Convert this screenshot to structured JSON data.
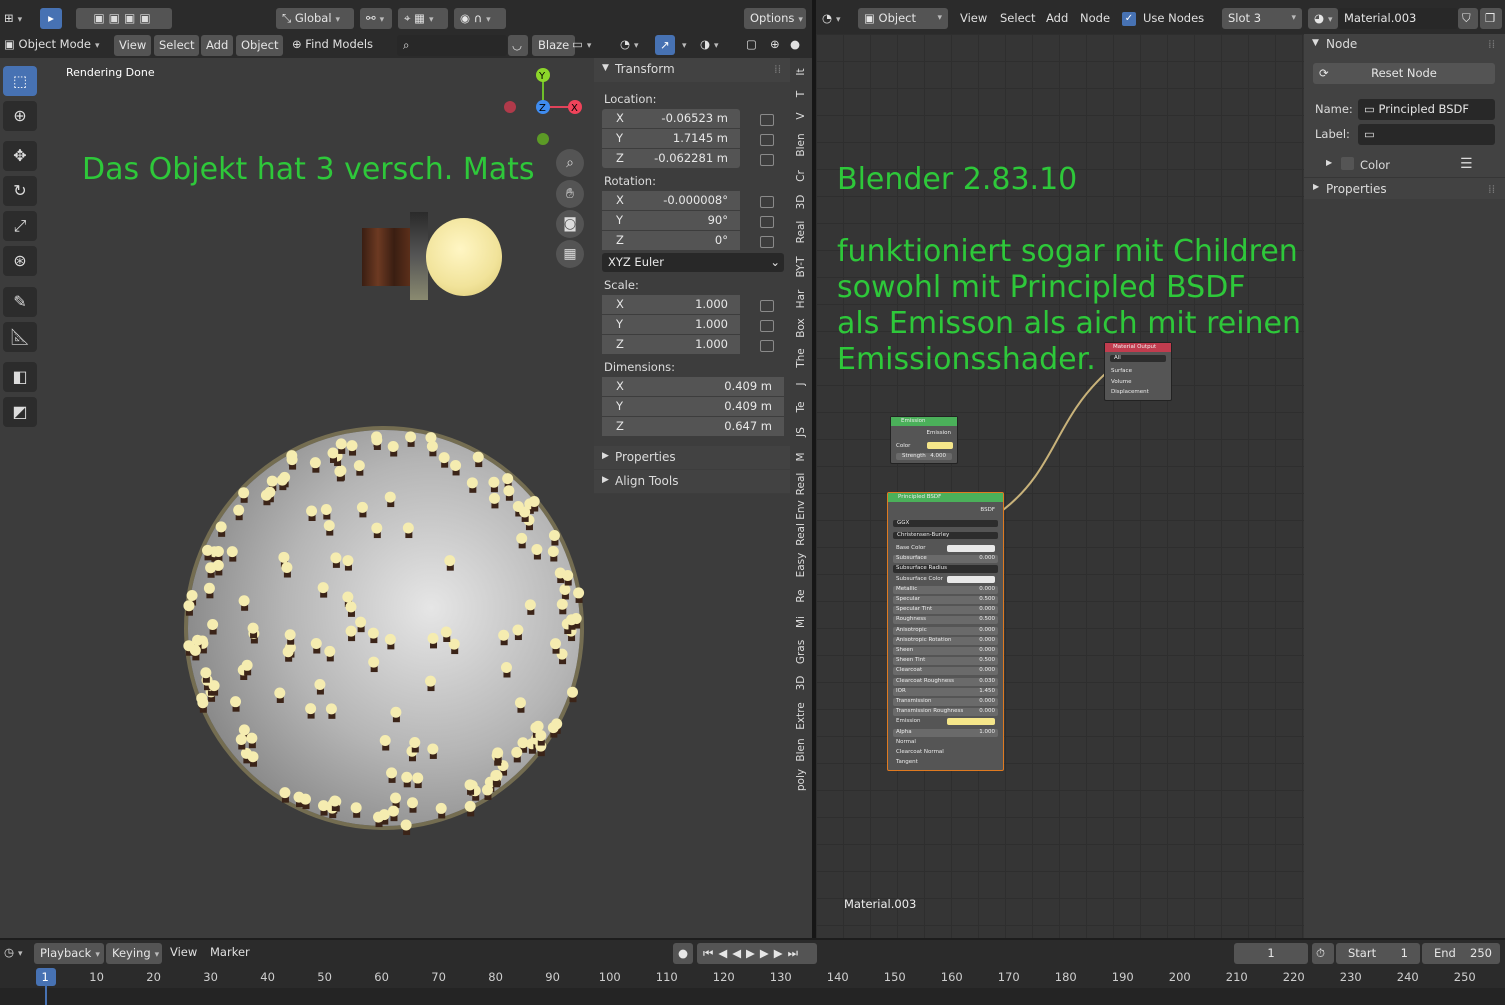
{
  "viewport": {
    "header": {
      "orientation": "Global",
      "options": "Options",
      "mode": "Object Mode",
      "menus": [
        "View",
        "Select",
        "Add",
        "Object"
      ],
      "find_models": "Find Models",
      "blaze": "Blaze"
    },
    "status_text": "Rendering Done",
    "overlay_text": "Das Objekt hat 3 versch. Mats"
  },
  "transform": {
    "title": "Transform",
    "location_label": "Location:",
    "location": [
      {
        "axis": "X",
        "value": "-0.06523 m"
      },
      {
        "axis": "Y",
        "value": "1.7145 m"
      },
      {
        "axis": "Z",
        "value": "-0.062281 m"
      }
    ],
    "rotation_label": "Rotation:",
    "rotation": [
      {
        "axis": "X",
        "value": "-0.000008°"
      },
      {
        "axis": "Y",
        "value": "90°"
      },
      {
        "axis": "Z",
        "value": "0°"
      }
    ],
    "rotation_mode": "XYZ Euler",
    "scale_label": "Scale:",
    "scale": [
      {
        "axis": "X",
        "value": "1.000"
      },
      {
        "axis": "Y",
        "value": "1.000"
      },
      {
        "axis": "Z",
        "value": "1.000"
      }
    ],
    "dimensions_label": "Dimensions:",
    "dimensions": [
      {
        "axis": "X",
        "value": "0.409 m"
      },
      {
        "axis": "Y",
        "value": "0.409 m"
      },
      {
        "axis": "Z",
        "value": "0.647 m"
      }
    ],
    "properties": "Properties",
    "align_tools": "Align Tools"
  },
  "vertical_tabs": [
    "It",
    "T",
    "V",
    "Blen",
    "Cr",
    "3D",
    "Real",
    "BY-T",
    "Har",
    "Box",
    "The",
    "J",
    "Te",
    "JS",
    "M",
    "Real",
    "Real Env",
    "Easy",
    "Re",
    "Mi",
    "Gras",
    "3D",
    "Extre",
    "Blen",
    "poly"
  ],
  "node_editor": {
    "header": {
      "object": "Object",
      "menus": [
        "View",
        "Select",
        "Add",
        "Node"
      ],
      "use_nodes": "Use Nodes",
      "slot": "Slot 3",
      "material": "Material.003"
    },
    "overlay_title": "Blender 2.83.10",
    "overlay_lines": [
      "funktioniert sogar mit Children",
      "sowohl mit Principled BSDF",
      "als Emisson als aich mit reinen",
      "Emissionsshader."
    ],
    "material_label": "Material.003",
    "nodes": {
      "emission": {
        "title": "Emission",
        "output": "Emission",
        "color": "Color",
        "strength": "Strength",
        "strength_value": "4.000"
      },
      "output": {
        "title": "Material Output",
        "target": "All",
        "inputs": [
          "Surface",
          "Volume",
          "Displacement"
        ]
      },
      "bsdf": {
        "title": "Principled BSDF",
        "output": "BSDF",
        "distribution": "GGX",
        "subsurface_method": "Christensen-Burley",
        "rows": [
          [
            "Base Color",
            ""
          ],
          [
            "Subsurface",
            "0.000"
          ],
          [
            "Subsurface Radius",
            ""
          ],
          [
            "Subsurface Color",
            ""
          ],
          [
            "Metallic",
            "0.000"
          ],
          [
            "Specular",
            "0.500"
          ],
          [
            "Specular Tint",
            "0.000"
          ],
          [
            "Roughness",
            "0.500"
          ],
          [
            "Anisotropic",
            "0.000"
          ],
          [
            "Anisotropic Rotation",
            "0.000"
          ],
          [
            "Sheen",
            "0.000"
          ],
          [
            "Sheen Tint",
            "0.500"
          ],
          [
            "Clearcoat",
            "0.000"
          ],
          [
            "Clearcoat Roughness",
            "0.030"
          ],
          [
            "IOR",
            "1.450"
          ],
          [
            "Transmission",
            "0.000"
          ],
          [
            "Transmission Roughness",
            "0.000"
          ],
          [
            "Emission",
            ""
          ],
          [
            "Alpha",
            "1.000"
          ],
          [
            "Normal",
            ""
          ],
          [
            "Clearcoat Normal",
            ""
          ],
          [
            "Tangent",
            ""
          ]
        ]
      }
    }
  },
  "sidebar": {
    "node_title": "Node",
    "reset_node": "Reset Node",
    "name_label": "Name:",
    "name_value": "Principled BSDF",
    "label_label": "Label:",
    "color_label": "Color",
    "properties": "Properties"
  },
  "timeline": {
    "menus": [
      "Playback",
      "Keying",
      "View",
      "Marker"
    ],
    "current_frame": "1",
    "start_label": "Start",
    "start_value": "1",
    "end_label": "End",
    "end_value": "250",
    "ticks": [
      "1",
      "10",
      "20",
      "30",
      "40",
      "50",
      "60",
      "70",
      "80",
      "90",
      "100",
      "110",
      "120",
      "130",
      "140",
      "150",
      "160",
      "170",
      "180",
      "190",
      "200",
      "210",
      "220",
      "230",
      "240",
      "250"
    ]
  },
  "colors": {
    "accent": "#4772b3",
    "green_text": "#2ec83a",
    "emission_yellow": "#f5e68a"
  }
}
